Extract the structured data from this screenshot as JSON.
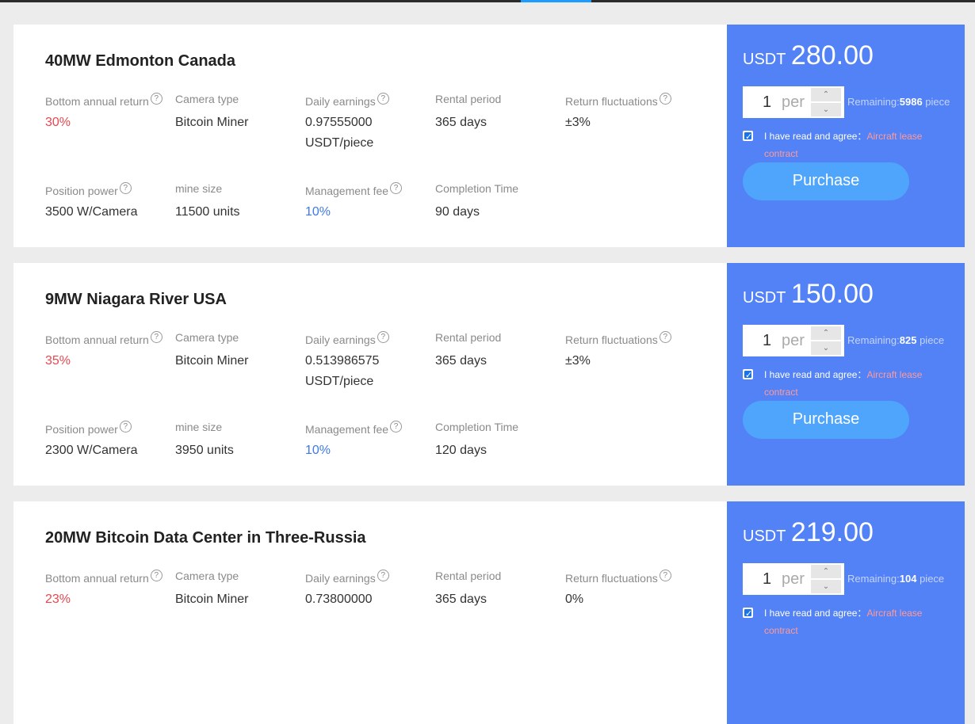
{
  "cards": [
    {
      "title": "40MW Edmonton Canada",
      "labels": {
        "annual_return": "Bottom annual return",
        "camera_type": "Camera type",
        "daily_earnings": "Daily earnings",
        "rental_period": "Rental period",
        "return_fluctuations": "Return fluctuations",
        "position_power": "Position power",
        "mine_size": "mine size",
        "management_fee": "Management fee",
        "completion_time": "Completion Time"
      },
      "values": {
        "annual_return": "30%",
        "camera_type": "Bitcoin Miner",
        "daily_earnings_1": "0.97555000",
        "daily_earnings_2": "USDT/piece",
        "rental_period": "365 days",
        "return_fluctuations": "±3%",
        "position_power": "3500 W/Camera",
        "mine_size": "11500 units",
        "management_fee": "10%",
        "completion_time": "90 days"
      },
      "price_currency": "USDT",
      "price_amount": "280.00",
      "quantity": "1",
      "unit": "per",
      "remaining_label": "Remaining:",
      "remaining_count": "5986",
      "remaining_unit": " piece",
      "agree_text": "I have read and agree：",
      "agree_link": "Aircraft lease contract",
      "purchase_label": "Purchase"
    },
    {
      "title": "9MW Niagara River USA",
      "labels": {
        "annual_return": "Bottom annual return",
        "camera_type": "Camera type",
        "daily_earnings": "Daily earnings",
        "rental_period": "Rental period",
        "return_fluctuations": "Return fluctuations",
        "position_power": "Position power",
        "mine_size": "mine size",
        "management_fee": "Management fee",
        "completion_time": "Completion Time"
      },
      "values": {
        "annual_return": "35%",
        "camera_type": "Bitcoin Miner",
        "daily_earnings_1": "0.513986575",
        "daily_earnings_2": "USDT/piece",
        "rental_period": "365 days",
        "return_fluctuations": "±3%",
        "position_power": "2300 W/Camera",
        "mine_size": "3950 units",
        "management_fee": "10%",
        "completion_time": "120 days"
      },
      "price_currency": "USDT",
      "price_amount": "150.00",
      "quantity": "1",
      "unit": "per",
      "remaining_label": "Remaining:",
      "remaining_count": "825",
      "remaining_unit": " piece",
      "agree_text": "I have read and agree：",
      "agree_link": "Aircraft lease contract",
      "purchase_label": "Purchase"
    },
    {
      "title": "20MW Bitcoin Data Center in Three-Russia",
      "labels": {
        "annual_return": "Bottom annual return",
        "camera_type": "Camera type",
        "daily_earnings": "Daily earnings",
        "rental_period": "Rental period",
        "return_fluctuations": "Return fluctuations"
      },
      "values": {
        "annual_return": "23%",
        "camera_type": "Bitcoin Miner",
        "daily_earnings_1": "0.73800000",
        "rental_period": "365 days",
        "return_fluctuations": "0%"
      },
      "price_currency": "USDT",
      "price_amount": "219.00",
      "quantity": "1",
      "unit": "per",
      "remaining_label": "Remaining:",
      "remaining_count": "104",
      "remaining_unit": " piece",
      "agree_text": "I have read and agree：",
      "agree_link": "Aircraft lease contract"
    }
  ],
  "icons": {
    "help": "?",
    "check": "✓",
    "up": "⌃",
    "down": "⌄"
  }
}
